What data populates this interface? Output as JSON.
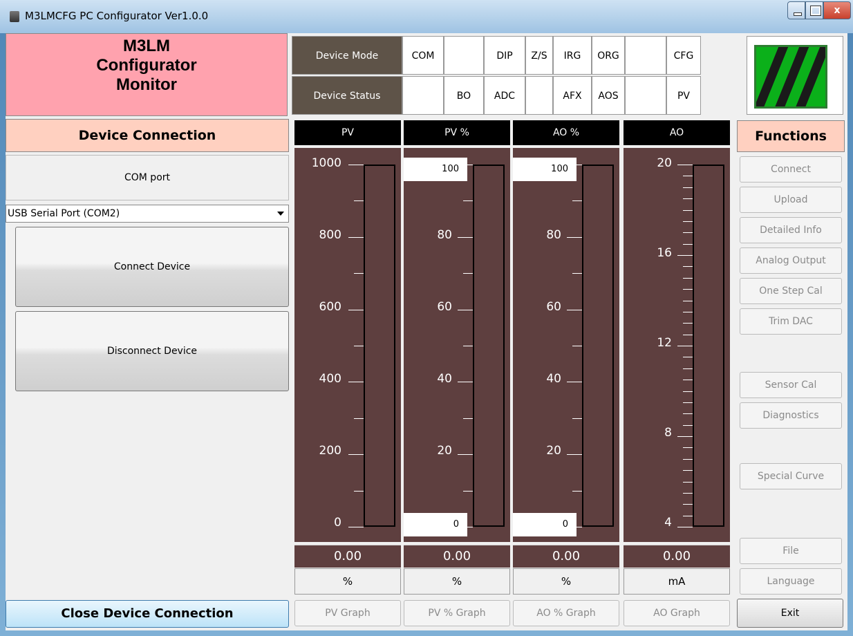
{
  "window": {
    "title": "M3LMCFG PC Configurator Ver1.0.0"
  },
  "header": {
    "monitor_lines": [
      "M3LM",
      "Configurator",
      "Monitor"
    ]
  },
  "mode_grid": {
    "mode_label": "Device Mode",
    "status_label": "Device Status",
    "mode_cells": [
      "COM",
      "",
      "DIP",
      "Z/S",
      "IRG",
      "ORG",
      "",
      "CFG"
    ],
    "status_cells": [
      "",
      "BO",
      "ADC",
      "",
      "AFX",
      "AOS",
      "",
      "PV"
    ]
  },
  "connection": {
    "header": "Device Connection",
    "com_port_label": "COM port",
    "com_port_value": "USB Serial Port (COM2)",
    "connect_button": "Connect Device",
    "disconnect_button": "Disconnect Device",
    "close_button": "Close Device Connection"
  },
  "meters": [
    {
      "title": "PV",
      "ticks": [
        "1000",
        "800",
        "600",
        "400",
        "200",
        "0"
      ],
      "value": "0.00",
      "unit": "%",
      "graph_button": "PV Graph"
    },
    {
      "title": "PV %",
      "ticks": [
        "80",
        "60",
        "40",
        "20"
      ],
      "top_box": "100",
      "bottom_box": "0",
      "value": "0.00",
      "unit": "%",
      "graph_button": "PV % Graph"
    },
    {
      "title": "AO %",
      "ticks": [
        "80",
        "60",
        "40",
        "20"
      ],
      "top_box": "100",
      "bottom_box": "0",
      "value": "0.00",
      "unit": "%",
      "graph_button": "AO % Graph"
    },
    {
      "title": "AO",
      "ticks": [
        "20",
        "16",
        "12",
        "8",
        "4"
      ],
      "value": "0.00",
      "unit": "mA",
      "graph_button": "AO Graph"
    }
  ],
  "functions": {
    "header": "Functions",
    "buttons": [
      "Connect",
      "Upload",
      "Detailed Info",
      "Analog Output",
      "One Step Cal",
      "Trim DAC",
      "Sensor Cal",
      "Diagnostics",
      "Special Curve",
      "File",
      "Language"
    ],
    "exit": "Exit"
  },
  "colors": {
    "meter_bg": "#5e3f3f",
    "monitor_bg": "#ffa2ae",
    "section_bg": "#ffd0c0",
    "logo_green": "#0bb01a"
  }
}
